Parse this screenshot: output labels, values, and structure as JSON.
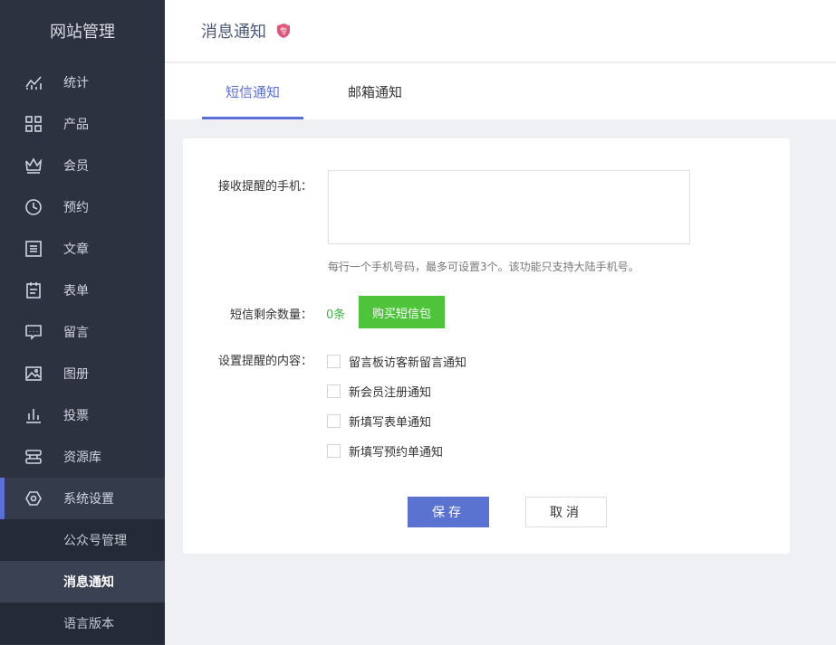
{
  "sidebar": {
    "site_title": "网站管理",
    "items": [
      {
        "label": "统计",
        "icon": "stats-icon"
      },
      {
        "label": "产品",
        "icon": "grid-icon"
      },
      {
        "label": "会员",
        "icon": "crown-icon"
      },
      {
        "label": "预约",
        "icon": "clock-icon"
      },
      {
        "label": "文章",
        "icon": "list-icon"
      },
      {
        "label": "表单",
        "icon": "clipboard-icon"
      },
      {
        "label": "留言",
        "icon": "message-icon"
      },
      {
        "label": "图册",
        "icon": "image-icon"
      },
      {
        "label": "投票",
        "icon": "bar-chart-icon"
      },
      {
        "label": "资源库",
        "icon": "database-icon"
      },
      {
        "label": "系统设置",
        "icon": "gear-icon"
      }
    ],
    "sub_items": [
      {
        "label": "公众号管理"
      },
      {
        "label": "消息通知"
      },
      {
        "label": "语言版本"
      }
    ]
  },
  "header": {
    "title": "消息通知",
    "badge": "专",
    "badge_color": "#e0557a"
  },
  "tabs": [
    {
      "label": "短信通知"
    },
    {
      "label": "邮箱通知"
    }
  ],
  "form": {
    "phone_label": "接收提醒的手机：",
    "phone_value": "",
    "phone_hint": "每行一个手机号码，最多可设置3个。该功能只支持大陆手机号。",
    "sms_label": "短信剩余数量：",
    "sms_count": "0条",
    "buy_label": "购买短信包",
    "content_label": "设置提醒的内容：",
    "options": [
      {
        "label": "留言板访客新留言通知"
      },
      {
        "label": "新会员注册通知"
      },
      {
        "label": "新填写表单通知"
      },
      {
        "label": "新填写预约单通知"
      }
    ],
    "save_label": "保存",
    "cancel_label": "取消"
  },
  "colors": {
    "accent": "#5b6fd6",
    "buy_green": "#4ec43b",
    "sidebar_bg": "#2c3240"
  }
}
